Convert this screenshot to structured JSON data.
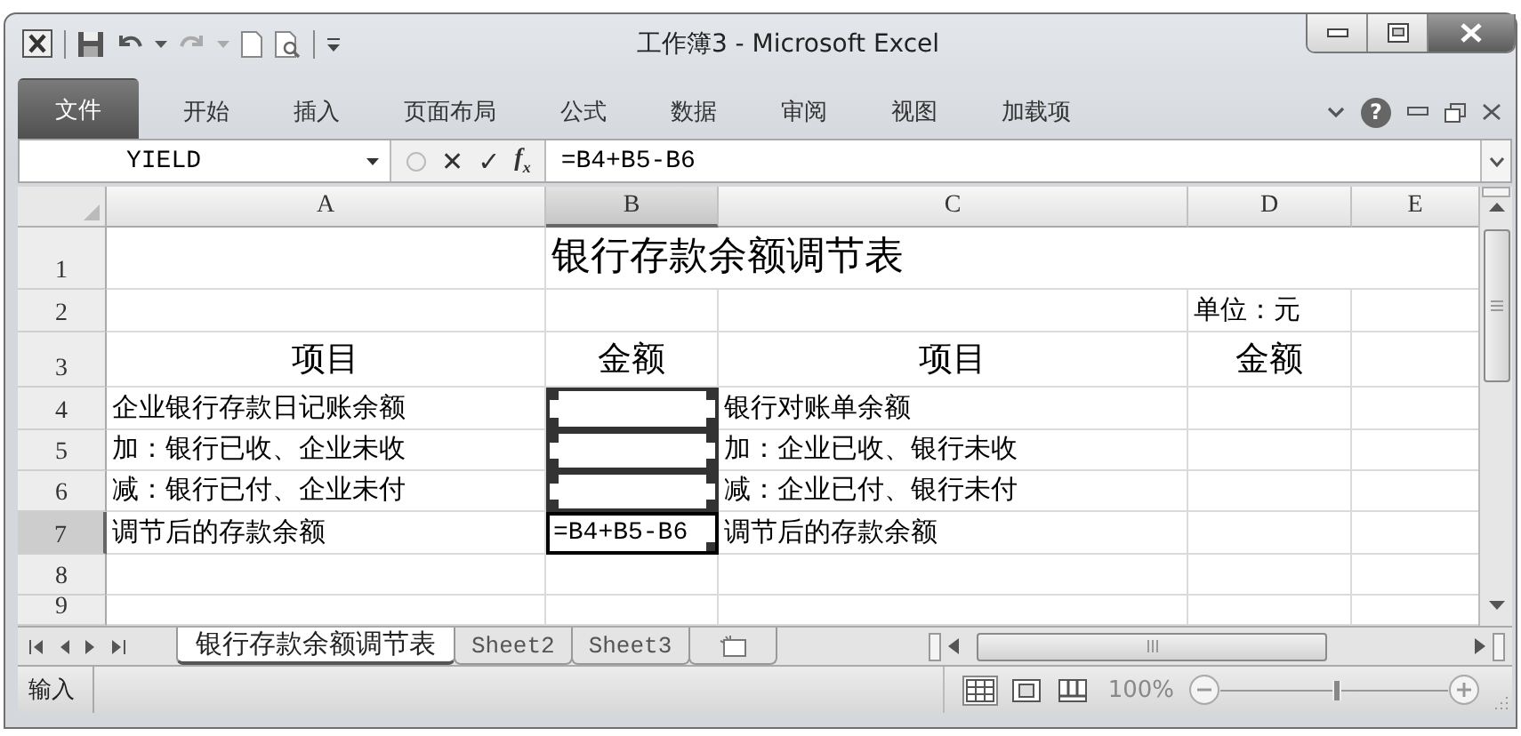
{
  "window": {
    "title": "工作簿3 - Microsoft Excel"
  },
  "ribbon": {
    "tabs": [
      {
        "label": "文件",
        "kind": "file",
        "selected": false
      },
      {
        "label": "开始",
        "kind": "tab",
        "selected": false
      },
      {
        "label": "插入",
        "kind": "tab",
        "selected": false
      },
      {
        "label": "页面布局",
        "kind": "tab",
        "selected": false
      },
      {
        "label": "公式",
        "kind": "tab",
        "selected": false
      },
      {
        "label": "数据",
        "kind": "tab",
        "selected": false
      },
      {
        "label": "审阅",
        "kind": "tab",
        "selected": false
      },
      {
        "label": "视图",
        "kind": "tab",
        "selected": false
      },
      {
        "label": "加载项",
        "kind": "tab",
        "selected": false
      }
    ],
    "help_symbol": "?"
  },
  "formula_bar": {
    "name_box": "YIELD",
    "cancel_symbol": "✕",
    "enter_symbol": "✓",
    "function_symbol": "f$_{x}$",
    "formula": "=B4+B5-B6"
  },
  "sheet": {
    "columns": [
      "A",
      "B",
      "C",
      "D",
      "E"
    ],
    "rows": [
      {
        "number": "1",
        "cells": [
          {
            "kind": "text",
            "referenced": false,
            "active": false
          },
          {
            "kind": "title",
            "text": "银行存款余额调节表",
            "referenced": false,
            "active": false
          }
        ]
      },
      {
        "number": "2",
        "cells": [
          {
            "kind": "text",
            "referenced": false,
            "active": false
          },
          {
            "kind": "text",
            "referenced": false,
            "active": false
          },
          {
            "kind": "text",
            "referenced": false,
            "active": false
          },
          {
            "kind": "text",
            "text": "单位：元",
            "referenced": false,
            "active": false
          },
          {
            "kind": "text",
            "referenced": false,
            "active": false
          }
        ]
      },
      {
        "number": "3",
        "cells": [
          {
            "kind": "heading",
            "text": "项目",
            "referenced": false,
            "active": false
          },
          {
            "kind": "heading",
            "text": "金额",
            "referenced": false,
            "active": false
          },
          {
            "kind": "heading",
            "text": "项目",
            "referenced": false,
            "active": false
          },
          {
            "kind": "heading",
            "text": "金额",
            "referenced": false,
            "active": false
          },
          {
            "kind": "text",
            "referenced": false,
            "active": false
          }
        ]
      },
      {
        "number": "4",
        "cells": [
          {
            "kind": "text",
            "text": "企业银行存款日记账余额",
            "referenced": false,
            "active": false
          },
          {
            "kind": "text",
            "referenced": true,
            "active": false
          },
          {
            "kind": "text",
            "text": "银行对账单余额",
            "referenced": false,
            "active": false
          },
          {
            "kind": "text",
            "referenced": false,
            "active": false
          },
          {
            "kind": "text",
            "referenced": false,
            "active": false
          }
        ]
      },
      {
        "number": "5",
        "cells": [
          {
            "kind": "text",
            "text": "加：银行已收、企业未收",
            "referenced": false,
            "active": false
          },
          {
            "kind": "text",
            "referenced": true,
            "active": false
          },
          {
            "kind": "text",
            "text": "加：企业已收、银行未收",
            "referenced": false,
            "active": false
          },
          {
            "kind": "text",
            "referenced": false,
            "active": false
          },
          {
            "kind": "text",
            "referenced": false,
            "active": false
          }
        ]
      },
      {
        "number": "6",
        "cells": [
          {
            "kind": "text",
            "text": "减：银行已付、企业未付",
            "referenced": false,
            "active": false
          },
          {
            "kind": "text",
            "referenced": true,
            "active": false
          },
          {
            "kind": "text",
            "text": "减：企业已付、银行未付",
            "referenced": false,
            "active": false
          },
          {
            "kind": "text",
            "referenced": false,
            "active": false
          },
          {
            "kind": "text",
            "referenced": false,
            "active": false
          }
        ]
      },
      {
        "number": "7",
        "cells": [
          {
            "kind": "text",
            "text": "调节后的存款余额",
            "referenced": false,
            "active": false
          },
          {
            "kind": "formula",
            "text": "=B4+B5-B6",
            "referenced": false,
            "active": true
          },
          {
            "kind": "text",
            "text": "调节后的存款余额",
            "referenced": false,
            "active": false
          },
          {
            "kind": "text",
            "referenced": false,
            "active": false
          },
          {
            "kind": "text",
            "referenced": false,
            "active": false
          }
        ]
      },
      {
        "number": "8",
        "cells": [
          {
            "kind": "text",
            "referenced": false,
            "active": false
          },
          {
            "kind": "text",
            "referenced": false,
            "active": false
          },
          {
            "kind": "text",
            "referenced": false,
            "active": false
          },
          {
            "kind": "text",
            "referenced": false,
            "active": false
          },
          {
            "kind": "text",
            "referenced": false,
            "active": false
          }
        ]
      },
      {
        "number": "9",
        "cells": [
          {
            "kind": "text",
            "referenced": false,
            "active": false
          },
          {
            "kind": "text",
            "referenced": false,
            "active": false
          },
          {
            "kind": "text",
            "referenced": false,
            "active": false
          },
          {
            "kind": "text",
            "referenced": false,
            "active": false
          },
          {
            "kind": "text",
            "referenced": false,
            "active": false
          }
        ]
      }
    ]
  },
  "sheet_tabs": [
    {
      "label": "银行存款余额调节表",
      "selected": true
    },
    {
      "label": "Sheet2",
      "selected": false
    },
    {
      "label": "Sheet3",
      "selected": false
    }
  ],
  "status_bar": {
    "mode": "输入",
    "views": [
      {
        "kind": "normal",
        "selected": true
      },
      {
        "kind": "page_layout",
        "selected": false
      },
      {
        "kind": "page_break",
        "selected": false
      }
    ],
    "zoom": "100%",
    "zoom_slider": {
      "level": 0.5
    }
  }
}
